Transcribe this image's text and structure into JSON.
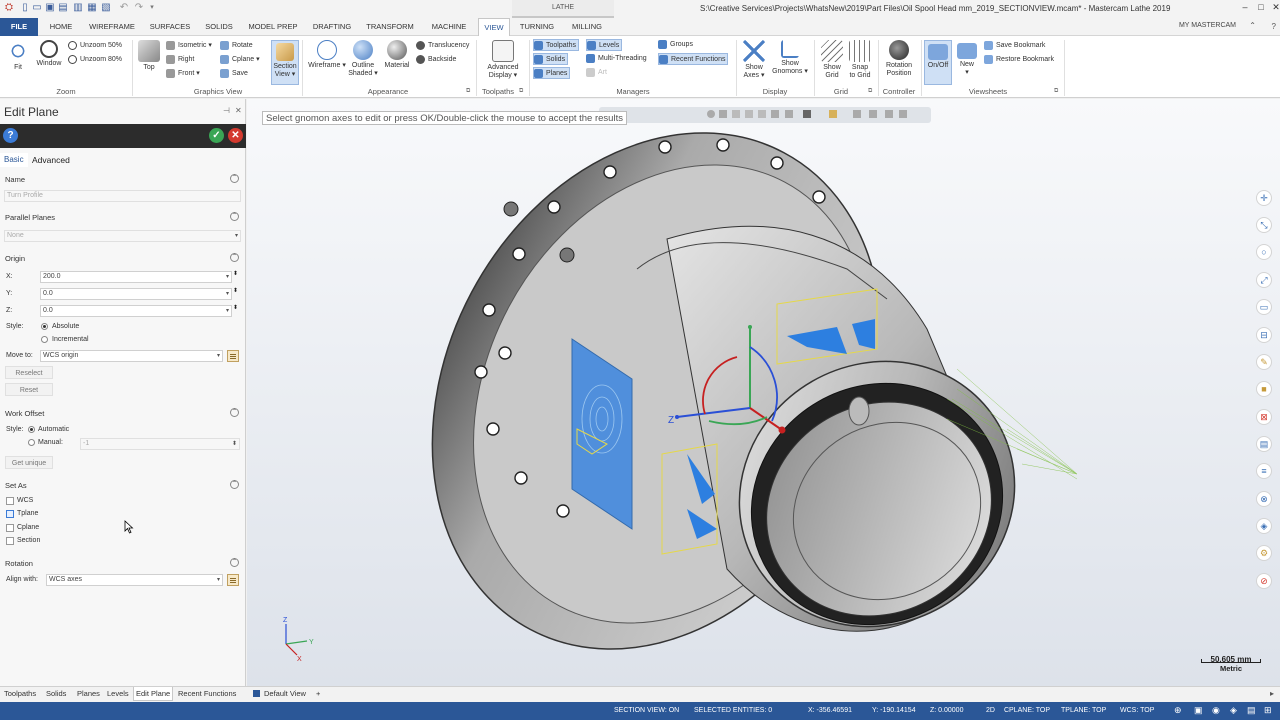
{
  "titlebar": {
    "context_tab": "LATHE",
    "title": "S:\\Creative Services\\Projects\\WhatsNew\\2019\\Part Files\\Oil Spool Head mm_2019_SECTIONVIEW.mcam* - Mastercam Lathe 2019",
    "minimize": "–",
    "maximize": "□",
    "close": "✕"
  },
  "tabs": [
    "FILE",
    "HOME",
    "WIREFRAME",
    "SURFACES",
    "SOLIDS",
    "MODEL PREP",
    "DRAFTING",
    "TRANSFORM",
    "MACHINE",
    "VIEW",
    "TURNING",
    "MILLING"
  ],
  "active_tab": "VIEW",
  "my_mastercam": "MY MASTERCAM",
  "ribbon": {
    "zoom": {
      "label": "Zoom",
      "fit": "Fit",
      "window": "Window",
      "unzoom50": "Unzoom 50%",
      "unzoom80": "Unzoom 80%"
    },
    "graphics_view": {
      "label": "Graphics View",
      "top": "Top",
      "isometric": "Isometric",
      "right": "Right",
      "front": "Front",
      "rotate": "Rotate",
      "cplane": "Cplane",
      "save": "Save",
      "section_view_1": "Section",
      "section_view_2": "View"
    },
    "appearance": {
      "label": "Appearance",
      "wireframe": "Wireframe",
      "outline_1": "Outline",
      "outline_2": "Shaded",
      "material": "Material",
      "translucency": "Translucency",
      "backside": "Backside"
    },
    "toolpaths": {
      "label": "Toolpaths",
      "advanced_1": "Advanced",
      "advanced_2": "Display"
    },
    "managers": {
      "label": "Managers",
      "toolpaths": "Toolpaths",
      "levels": "Levels",
      "solids": "Solids",
      "planes": "Planes",
      "art": "Art",
      "groups": "Groups",
      "multithreading": "Multi-Threading",
      "recent_functions": "Recent Functions"
    },
    "display": {
      "label": "Display",
      "show_axes_1": "Show",
      "show_axes_2": "Axes",
      "show_gnomons_1": "Show",
      "show_gnomons_2": "Gnomons"
    },
    "grid": {
      "label": "Grid",
      "show_grid_1": "Show",
      "show_grid_2": "Grid",
      "snap_grid_1": "Snap",
      "snap_grid_2": "to Grid"
    },
    "controller": {
      "label": "Controller",
      "rotation_1": "Rotation",
      "rotation_2": "Position"
    },
    "viewsheets": {
      "label": "Viewsheets",
      "onoff": "On/Off",
      "new": "New",
      "save_bookmark": "Save Bookmark",
      "restore_bookmark": "Restore Bookmark"
    }
  },
  "panel": {
    "title": "Edit Plane",
    "tab_basic": "Basic",
    "tab_advanced": "Advanced",
    "name_section": "Name",
    "name_placeholder": "Turn Profile",
    "parallel_section": "Parallel Planes",
    "parallel_value": "None",
    "origin_section": "Origin",
    "x_label": "X:",
    "x_value": "200.0",
    "y_label": "Y:",
    "y_value": "0.0",
    "z_label": "Z:",
    "z_value": "0.0",
    "style_label": "Style:",
    "absolute": "Absolute",
    "incremental": "Incremental",
    "move_to_label": "Move to:",
    "move_to_value": "WCS origin",
    "reselect": "Reselect",
    "reset": "Reset",
    "work_offset_section": "Work Offset",
    "automatic": "Automatic",
    "manual": "Manual:",
    "manual_value": "-1",
    "get_unique": "Get unique",
    "set_as_section": "Set As",
    "wcs": "WCS",
    "tplane": "Tplane",
    "cplane": "Cplane",
    "section": "Section",
    "rotation_section": "Rotation",
    "align_label": "Align with:",
    "align_value": "WCS axes"
  },
  "viewport": {
    "prompt": "Select gnomon axes to edit or press OK/Double-click the mouse to accept the results",
    "scale_value": "50.605 mm",
    "scale_unit": "Metric",
    "gnomon_z": "Z",
    "small_z": "Z",
    "small_y": "Y",
    "small_x": "X"
  },
  "bottom_tabs": [
    "Toolpaths",
    "Solids",
    "Planes",
    "Levels",
    "Edit Plane",
    "Recent Functions"
  ],
  "viewsheet_tab": "Default View",
  "viewsheet_add": "+",
  "status": {
    "section_view": "SECTION VIEW: ON",
    "selected": "SELECTED ENTITIES: 0",
    "x": "X:   -356.46591",
    "y": "Y:   -190.14154",
    "z": "Z:   0.00000",
    "mode": "2D",
    "cplane": "CPLANE: TOP",
    "tplane": "TPLANE: TOP",
    "wcs": "WCS: TOP"
  }
}
